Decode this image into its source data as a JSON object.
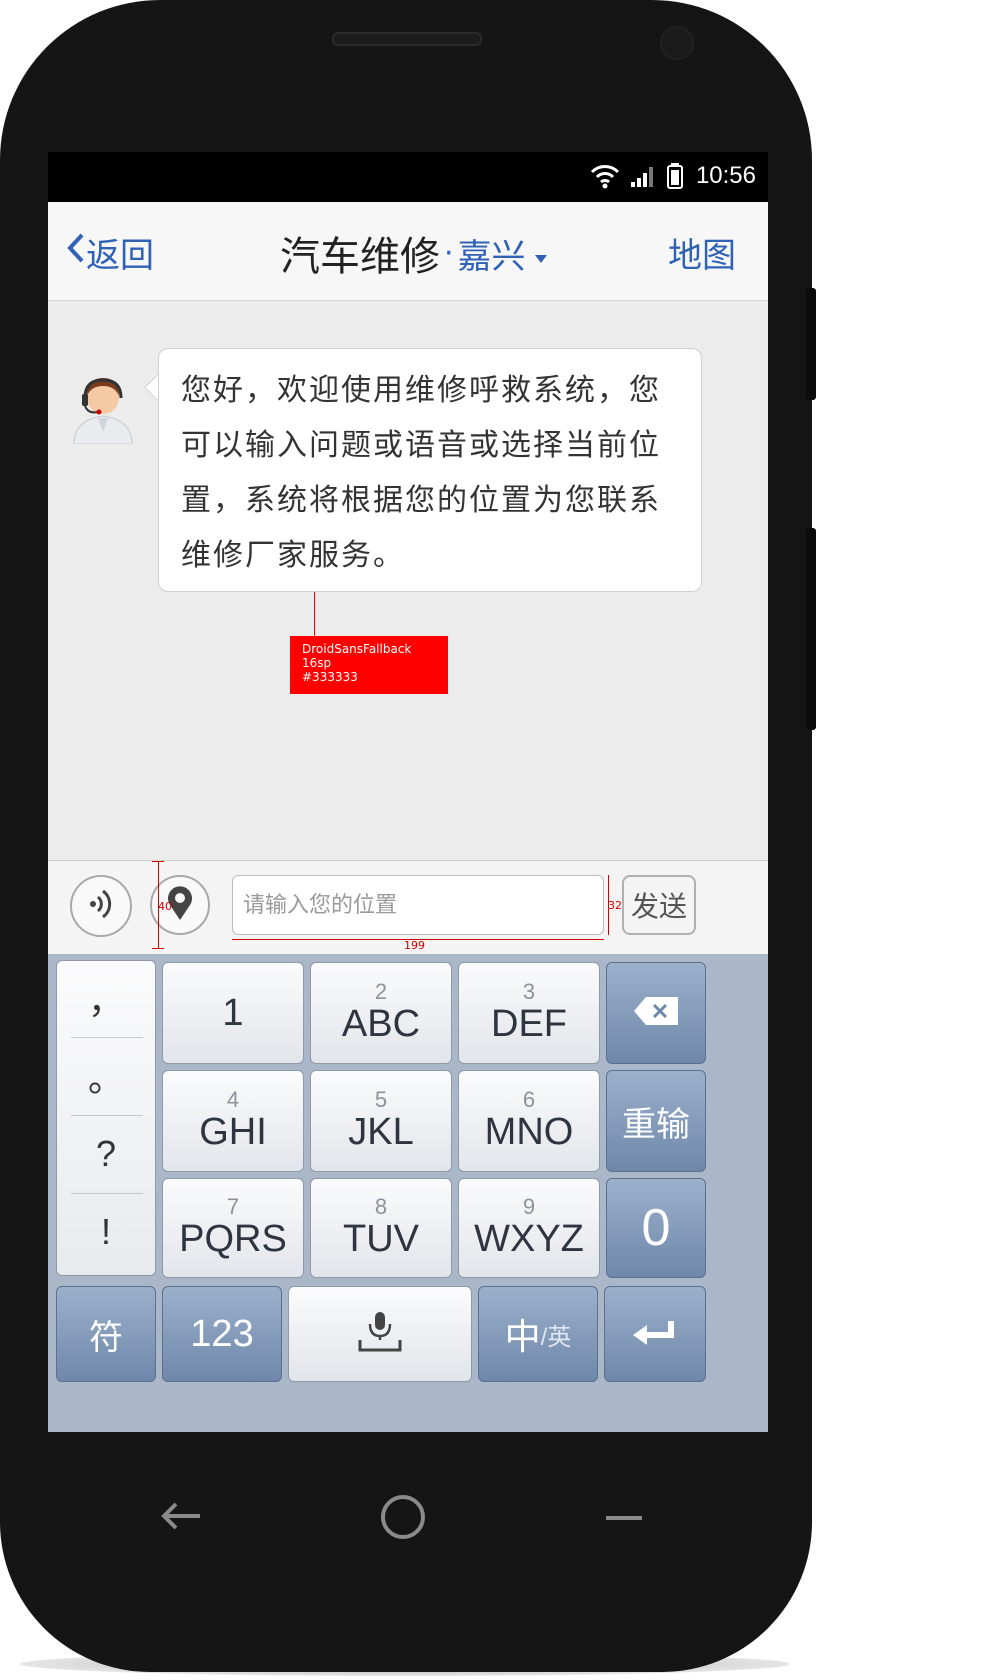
{
  "status_bar": {
    "time": "10:56",
    "icons": [
      "wifi-icon",
      "signal-icon",
      "battery-icon"
    ]
  },
  "nav_bar": {
    "back_label": "返回",
    "title": "汽车维修",
    "title_separator": "·",
    "city": "嘉兴",
    "map_label": "地图"
  },
  "chat": {
    "messages": [
      {
        "sender": "support-agent",
        "text": "您好，欢迎使用维修呼救系统，您可以输入问题或语音或选择当前位置，系统将根据您的位置为您联系维修厂家服务。"
      }
    ]
  },
  "annotations": {
    "text_spec": [
      "DroidSansFallback",
      "16sp",
      "#333333"
    ],
    "height_marker": "40",
    "input_height_marker": "32",
    "input_width_marker": "199"
  },
  "input_bar": {
    "placeholder": "请输入您的位置",
    "send_label": "发送"
  },
  "keyboard": {
    "punctuation": [
      "，",
      "。",
      "?",
      "!"
    ],
    "rows": [
      [
        {
          "num": "",
          "label": "1"
        },
        {
          "num": "2",
          "label": "ABC"
        },
        {
          "num": "3",
          "label": "DEF"
        }
      ],
      [
        {
          "num": "4",
          "label": "GHI"
        },
        {
          "num": "5",
          "label": "JKL"
        },
        {
          "num": "6",
          "label": "MNO"
        }
      ],
      [
        {
          "num": "7",
          "label": "PQRS"
        },
        {
          "num": "8",
          "label": "TUV"
        },
        {
          "num": "9",
          "label": "WXYZ"
        }
      ]
    ],
    "side_keys": [
      "backspace-icon",
      "重输",
      "0"
    ],
    "bottom": {
      "symbols": "符",
      "numbers": "123",
      "space": "microphone-space-icon",
      "lang_main": "中",
      "lang_alt": "/英",
      "enter": "enter-icon"
    }
  },
  "colors": {
    "accent": "#2f62b5",
    "bubble_text": "#333333",
    "annotation": "#ff0000"
  }
}
